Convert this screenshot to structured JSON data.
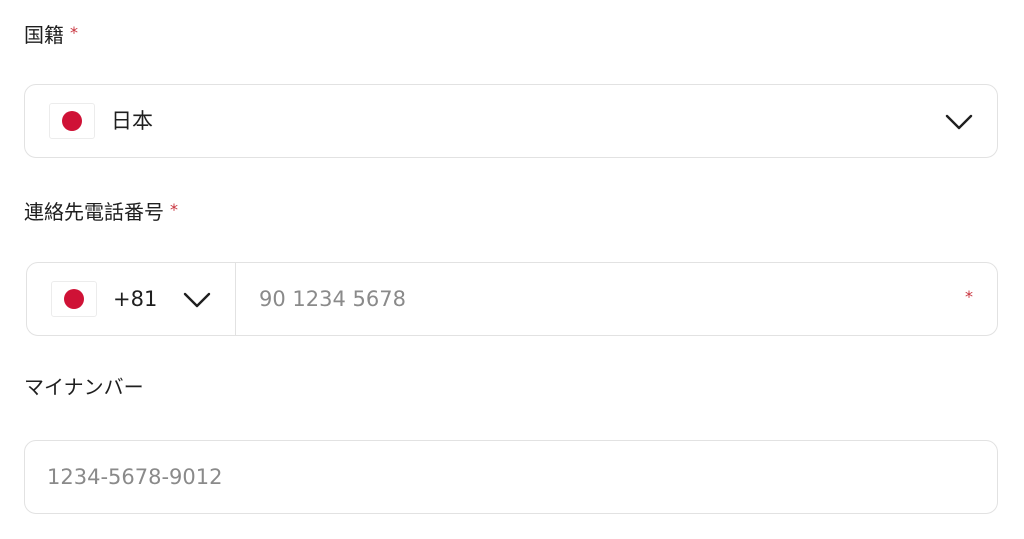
{
  "nationality": {
    "label": "国籍",
    "required_mark": "*",
    "selected_value": "日本",
    "flag": "japan-flag-icon",
    "dropdown_icon": "chevron-down-icon"
  },
  "phone": {
    "label": "連絡先電話番号",
    "required_mark": "*",
    "country_code": "+81",
    "flag": "japan-flag-icon",
    "dropdown_icon": "chevron-down-icon",
    "placeholder": "90 1234 5678",
    "field_required_mark": "*"
  },
  "my_number": {
    "label": "マイナンバー",
    "placeholder": "1234-5678-9012"
  },
  "colors": {
    "required": "#c8323c",
    "flag_red": "#cf1236",
    "border": "#e2e2e2",
    "placeholder": "#8a8a8a"
  }
}
